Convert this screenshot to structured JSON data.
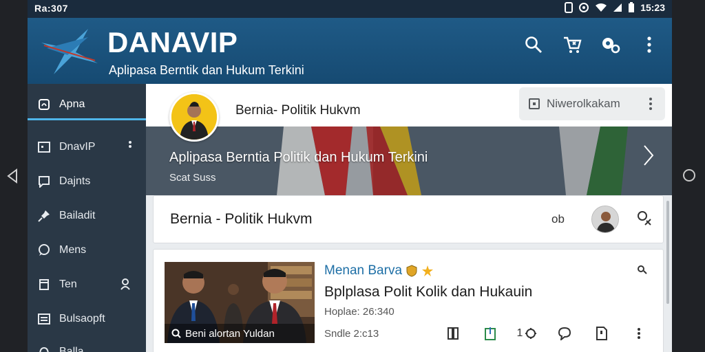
{
  "status_bar": {
    "left_text": "Ra:307",
    "time": "15:23"
  },
  "header": {
    "brand": "DANAVIP",
    "tagline": "Aplipasa Berntik dan Hukum Terkini",
    "icons": [
      "search-icon",
      "cart-icon",
      "settings-icon",
      "more-icon"
    ]
  },
  "sidebar": {
    "items": [
      {
        "label": "Apna",
        "icon": "home-icon",
        "active": true
      },
      {
        "label": "DnavIP",
        "icon": "list-icon"
      },
      {
        "label": "Dajnts",
        "icon": "chat-icon"
      },
      {
        "label": "Bailadit",
        "icon": "pin-icon"
      },
      {
        "label": "Mens",
        "icon": "bubble-icon"
      },
      {
        "label": "Ten",
        "icon": "tag-icon"
      },
      {
        "label": "Bulsaopft",
        "icon": "grid-icon"
      },
      {
        "label": "Balla",
        "icon": "bell-icon"
      }
    ]
  },
  "profile_bar": {
    "title": "Bernia- Politik Hukvm",
    "chip_label": "Niwerolkakam"
  },
  "banner": {
    "title": "Aplipasa Berntia Politik dan Hukum Terkini",
    "subtitle": "Scat Suss"
  },
  "topic_card": {
    "title": "Bernia - Politik Hukvm",
    "count": "ob"
  },
  "article": {
    "source": "Menan Barva",
    "headline": "Bplplasa Polit  Kolik dan Hukauin",
    "meta1": "Hoplae: 26:340",
    "meta2": "Sndle 2:c13",
    "thumb_caption": "Beni alortan   Yuldan",
    "actions": [
      {
        "icon": "book-icon",
        "label": ""
      },
      {
        "icon": "bookmark-icon",
        "label": ""
      },
      {
        "icon": "share-icon",
        "label": "1"
      },
      {
        "icon": "comment-icon",
        "label": ""
      },
      {
        "icon": "save-icon",
        "label": ""
      },
      {
        "icon": "more-icon",
        "label": ""
      }
    ]
  },
  "colors": {
    "header_bg": "#1f5a86",
    "sidebar_bg": "#2a3846",
    "accent": "#4fb6ea",
    "source_blue": "#1e6fa6",
    "status_bg": "#1a2b3d"
  }
}
